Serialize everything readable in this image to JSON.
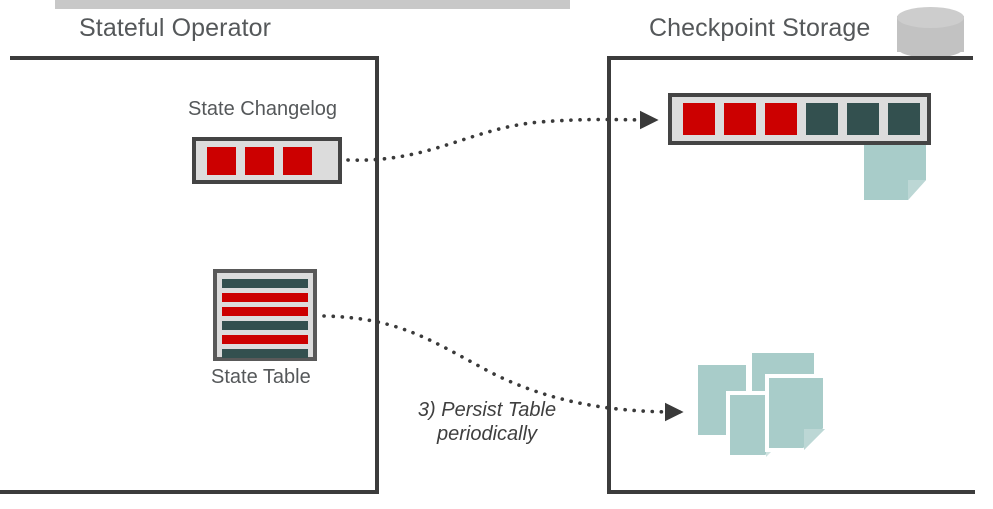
{
  "diagram": {
    "title_bar_color": "#c8c8c8",
    "panels": {
      "left": {
        "title": "Stateful Operator"
      },
      "right": {
        "title": "Checkpoint Storage",
        "icon": "database-cylinder-icon"
      }
    },
    "left_panel": {
      "changelog": {
        "caption": "State Changelog",
        "cells": [
          "red",
          "red",
          "red"
        ]
      },
      "state_table": {
        "caption": "State Table",
        "rows": [
          "teal",
          "red",
          "red",
          "teal",
          "red",
          "teal"
        ]
      }
    },
    "right_panel": {
      "changelog": {
        "cells": [
          "red",
          "red",
          "red",
          "teal",
          "teal",
          "teal"
        ]
      },
      "page_icons": {
        "near_changelog": 1,
        "stack": 4
      }
    },
    "annotation": {
      "line1": "3) Persist Table",
      "line2": "periodically"
    },
    "arrows": [
      {
        "name": "changelog-to-storage",
        "style": "dotted",
        "head": "triangle"
      },
      {
        "name": "table-to-storage",
        "style": "dotted",
        "head": "triangle"
      }
    ],
    "colors": {
      "red": "#cc0000",
      "teal": "#33504f",
      "page_teal": "#a8ccc9",
      "frame": "#3c3c3c",
      "box_fill": "#dcdcdc",
      "text": "#55585a",
      "cylinder": "#c2c2c2"
    }
  }
}
